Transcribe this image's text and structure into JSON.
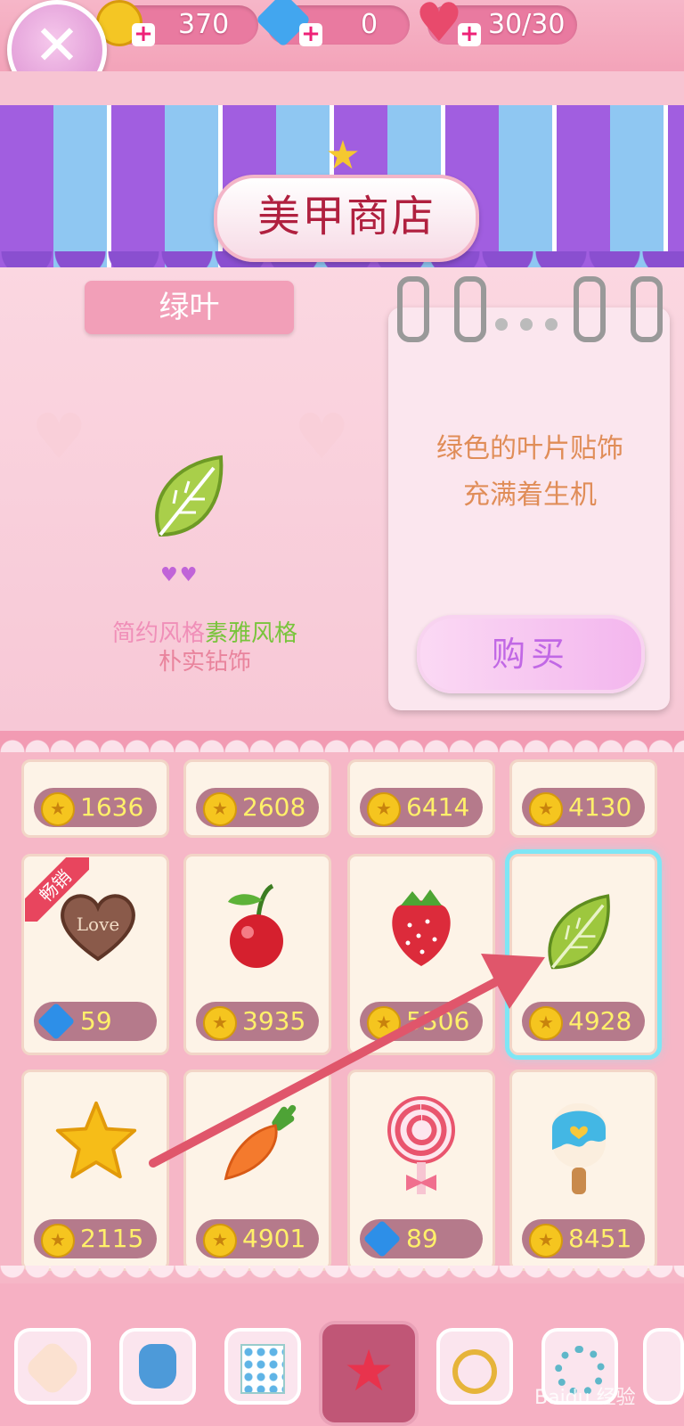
{
  "topbar": {
    "coins": "370",
    "gems": "0",
    "hearts": "30/30",
    "plus": "+",
    "close": "✕"
  },
  "shop": {
    "title": "美甲商店"
  },
  "item": {
    "name": "绿叶",
    "tags": [
      "简约风格",
      "素雅风格",
      "朴实钻饰"
    ],
    "selected_tag": "素雅风格",
    "description_line1": "绿色的叶片贴饰",
    "description_line2": "充满着生机",
    "hearts": "♥♥",
    "buy_label": "购买"
  },
  "grid": {
    "row0": [
      {
        "currency": "coin",
        "price": "1636"
      },
      {
        "currency": "coin",
        "price": "2608"
      },
      {
        "currency": "coin",
        "price": "6414"
      },
      {
        "currency": "coin",
        "price": "4130"
      }
    ],
    "row1": [
      {
        "icon": "love-heart-chocolate-icon",
        "currency": "gem",
        "price": "59",
        "badge": "畅销"
      },
      {
        "icon": "cherry-icon",
        "currency": "coin",
        "price": "3935"
      },
      {
        "icon": "strawberry-icon",
        "currency": "coin",
        "price": "5306"
      },
      {
        "icon": "green-leaf-icon",
        "currency": "coin",
        "price": "4928",
        "selected": true
      }
    ],
    "row2": [
      {
        "icon": "star-icon",
        "currency": "coin",
        "price": "2115"
      },
      {
        "icon": "carrot-icon",
        "currency": "coin",
        "price": "4901"
      },
      {
        "icon": "lollipop-icon",
        "currency": "gem",
        "price": "89"
      },
      {
        "icon": "popsicle-icon",
        "currency": "coin",
        "price": "8451"
      }
    ]
  },
  "tabs": [
    {
      "icon": "makeup-pad-icon"
    },
    {
      "icon": "perfume-bottle-icon"
    },
    {
      "icon": "polka-dot-paper-icon"
    },
    {
      "icon": "star-decal-icon",
      "active": true
    },
    {
      "icon": "ring-icon"
    },
    {
      "icon": "pearl-bracelet-icon"
    },
    {
      "icon": "more-tab-icon"
    }
  ],
  "watermark": "Baidu 经验"
}
